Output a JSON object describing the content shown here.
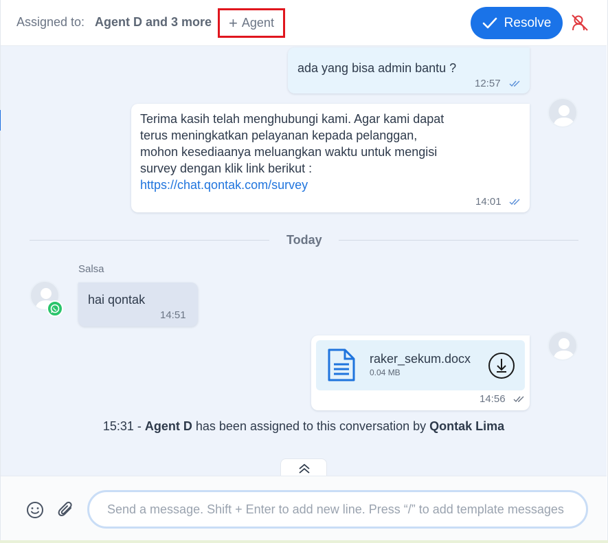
{
  "header": {
    "assigned_label": "Assigned to:",
    "assigned_agents": "Agent D and 3 more",
    "add_agent_label": "Agent",
    "resolve_label": "Resolve"
  },
  "messages": {
    "outgoing_1": {
      "text": "ada yang bisa admin bantu ?",
      "time": "12:57"
    },
    "bot_survey": {
      "lines": [
        "Terima kasih telah menghubungi kami. Agar kami dapat",
        "terus meningkatkan pelayanan kepada pelanggan,",
        "mohon kesediaanya meluangkan waktu untuk mengisi",
        "survey dengan klik link berikut :"
      ],
      "link": "https://chat.qontak.com/survey",
      "time": "14:01"
    },
    "divider": "Today",
    "incoming_1": {
      "sender": "Salsa",
      "text": "hai qontak",
      "time": "14:51"
    },
    "file_message": {
      "file_name": "raker_sekum.docx",
      "file_size": "0.04 MB",
      "time": "14:56"
    },
    "system": {
      "time": "15:31",
      "separator": " - ",
      "agent": "Agent D",
      "middle": " has been assigned to this conversation by ",
      "by": "Qontak Lima"
    }
  },
  "composer": {
    "placeholder": "Send a message. Shift + Enter to add new line. Press “/” to add template messages"
  },
  "colors": {
    "accent": "#1a73e8",
    "highlight_border": "#e0161e",
    "whatsapp": "#2ac46b",
    "chat_background": "#eef3fb"
  },
  "icons": [
    "plus-icon",
    "check-icon",
    "unassign-icon",
    "double-check-icon",
    "user-avatar-icon",
    "whatsapp-icon",
    "document-icon",
    "download-icon",
    "chevron-up-icon",
    "emoji-icon",
    "paperclip-icon"
  ]
}
